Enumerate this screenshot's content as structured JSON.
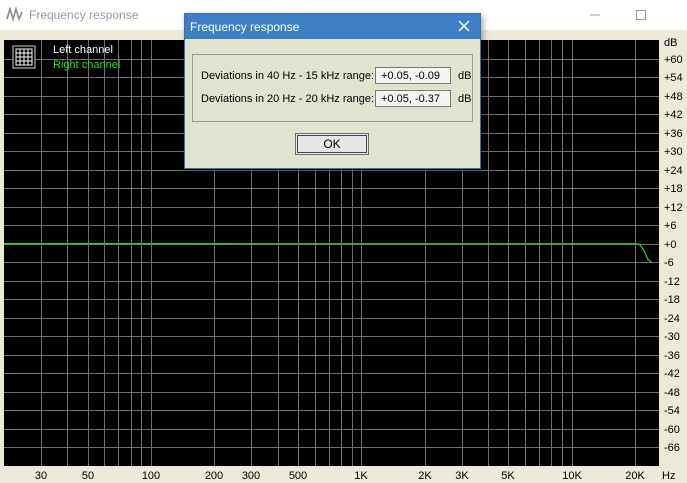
{
  "window": {
    "title": "Frequency response",
    "icon": "waveform-icon"
  },
  "legend": {
    "left_channel": "Left channel",
    "right_channel": "Right channel",
    "left_color": "#ffffff",
    "right_color": "#22e022"
  },
  "chart_data": {
    "type": "line",
    "x_scale": "log",
    "xlim": [
      20,
      26000
    ],
    "ylim": [
      -72,
      66
    ],
    "y_unit": "dB",
    "x_unit": "Hz",
    "y_ticks": [
      "+60",
      "+54",
      "+48",
      "+42",
      "+36",
      "+30",
      "+24",
      "+18",
      "+12",
      "+6",
      "+0",
      "-6",
      "-12",
      "-18",
      "-24",
      "-30",
      "-36",
      "-42",
      "-48",
      "-54",
      "-60",
      "-66"
    ],
    "y_tick_values": [
      60,
      54,
      48,
      42,
      36,
      30,
      24,
      18,
      12,
      6,
      0,
      -6,
      -12,
      -18,
      -24,
      -30,
      -36,
      -42,
      -48,
      -54,
      -60,
      -66
    ],
    "x_ticks": [
      {
        "label": "30",
        "value": 30
      },
      {
        "label": "50",
        "value": 50
      },
      {
        "label": "100",
        "value": 100
      },
      {
        "label": "200",
        "value": 200
      },
      {
        "label": "300",
        "value": 300
      },
      {
        "label": "500",
        "value": 500
      },
      {
        "label": "1K",
        "value": 1000
      },
      {
        "label": "2K",
        "value": 2000
      },
      {
        "label": "3K",
        "value": 3000
      },
      {
        "label": "5K",
        "value": 5000
      },
      {
        "label": "10K",
        "value": 10000
      },
      {
        "label": "20K",
        "value": 20000
      }
    ],
    "series": [
      {
        "name": "Right channel",
        "color": "#22e022",
        "x": [
          20,
          1000,
          20000,
          21000,
          22000,
          23000,
          24000
        ],
        "y": [
          0.05,
          0,
          0,
          -0.2,
          -2,
          -5,
          -6
        ]
      }
    ]
  },
  "dialog": {
    "title": "Frequency response",
    "row1_label": "Deviations in 40 Hz - 15 kHz range:",
    "row1_value": "+0.05, -0.09",
    "row2_label": "Deviations in 20 Hz - 20 kHz range:",
    "row2_value": "+0.05, -0.37",
    "unit": "dB",
    "ok_label": "OK"
  }
}
